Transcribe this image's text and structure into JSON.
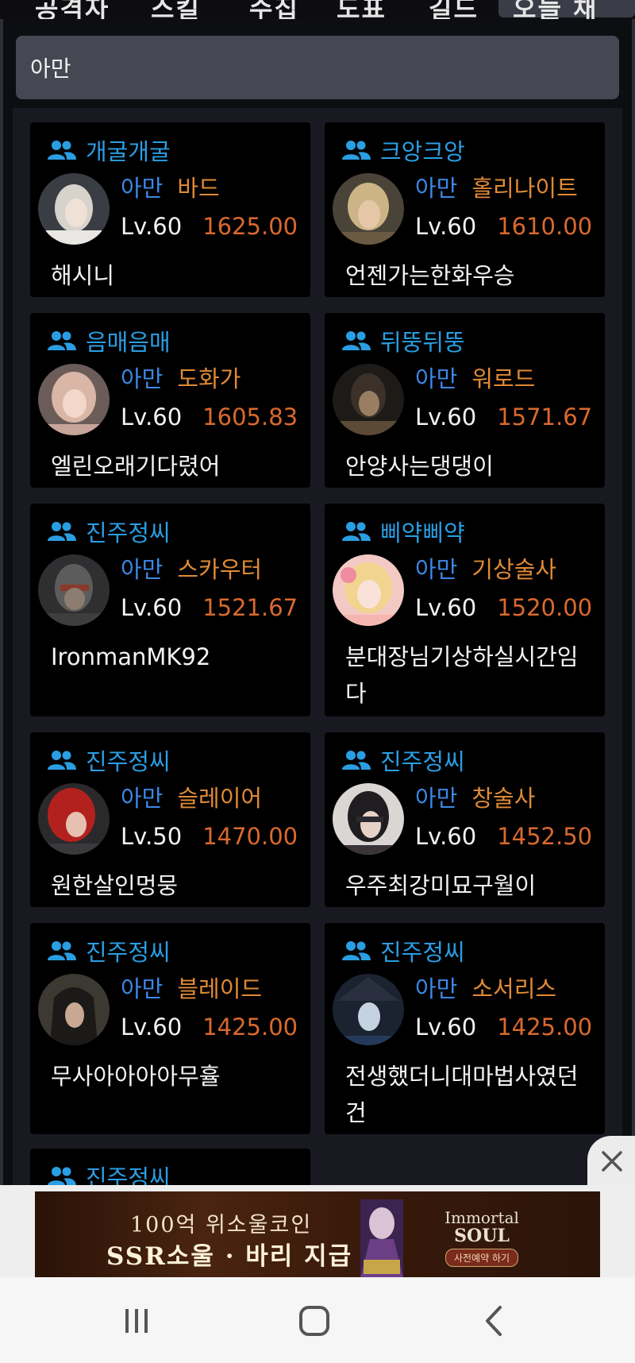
{
  "tabs": [
    {
      "label": "공격자"
    },
    {
      "label": "스킬"
    },
    {
      "label": "수집"
    },
    {
      "label": "도표"
    },
    {
      "label": "길드"
    },
    {
      "label": "오늘 채팅"
    }
  ],
  "search": {
    "value": "아만"
  },
  "colors": {
    "guild": "#2a9ee3",
    "server": "#3c88e6",
    "class": "#e08a36",
    "score": "#d9692e",
    "card_bg": "#000000"
  },
  "characters": [
    {
      "guild": "개굴개굴",
      "server": "아만",
      "class": "바드",
      "level": "Lv.60",
      "score": "1625.00",
      "nickname": "해시니",
      "avatar_icon": "character-portrait-silver-hair"
    },
    {
      "guild": "크앙크앙",
      "server": "아만",
      "class": "홀리나이트",
      "level": "Lv.60",
      "score": "1610.00",
      "nickname": "언젠가는한화우승",
      "avatar_icon": "character-portrait-blond"
    },
    {
      "guild": "음매음매",
      "server": "아만",
      "class": "도화가",
      "level": "Lv.60",
      "score": "1605.83",
      "nickname": "엘린오래기다렸어",
      "avatar_icon": "character-portrait-pink"
    },
    {
      "guild": "뒤뚱뒤뚱",
      "server": "아만",
      "class": "워로드",
      "level": "Lv.60",
      "score": "1571.67",
      "nickname": "안양사는댕댕이",
      "avatar_icon": "character-portrait-dark"
    },
    {
      "guild": "진주정씨",
      "server": "아만",
      "class": "스카우터",
      "level": "Lv.60",
      "score": "1521.67",
      "nickname": "IronmanMK92",
      "avatar_icon": "character-portrait-mech"
    },
    {
      "guild": "삐약삐약",
      "server": "아만",
      "class": "기상술사",
      "level": "Lv.60",
      "score": "1520.00",
      "nickname": "분대장님기상하실시간임다",
      "avatar_icon": "character-portrait-blonde-girl"
    },
    {
      "guild": "진주정씨",
      "server": "아만",
      "class": "슬레이어",
      "level": "Lv.50",
      "score": "1470.00",
      "nickname": "원한살인멍뭉",
      "avatar_icon": "character-portrait-red-hair"
    },
    {
      "guild": "진주정씨",
      "server": "아만",
      "class": "창술사",
      "level": "Lv.60",
      "score": "1452.50",
      "nickname": "우주최강미묘구월이",
      "avatar_icon": "character-portrait-blindfold"
    },
    {
      "guild": "진주정씨",
      "server": "아만",
      "class": "블레이드",
      "level": "Lv.60",
      "score": "1425.00",
      "nickname": "무사아아아아무휼",
      "avatar_icon": "character-portrait-hooded"
    },
    {
      "guild": "진주정씨",
      "server": "아만",
      "class": "소서리스",
      "level": "Lv.60",
      "score": "1425.00",
      "nickname": "전생했더니대마법사였던건",
      "avatar_icon": "character-portrait-witch-hat"
    },
    {
      "guild": "진주정씨"
    }
  ],
  "ad": {
    "line1": "100억 위소울코인",
    "line2": "SSR소울 · 바리 지급",
    "logo_a": "Immortal",
    "logo_b": "SOUL",
    "logo_c": "사전예약 하기",
    "close_icon": "close-icon"
  },
  "navbar": {
    "recent_icon": "recent-apps-icon",
    "home_icon": "home-icon",
    "back_icon": "back-icon"
  }
}
